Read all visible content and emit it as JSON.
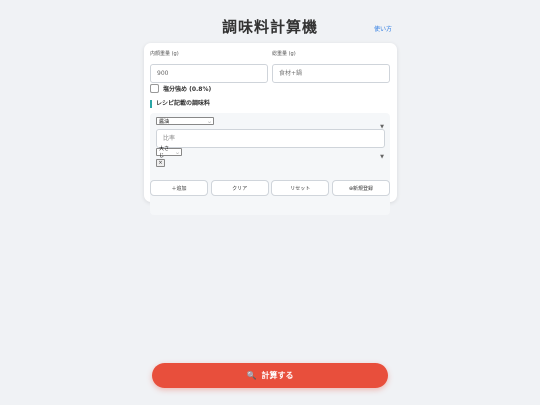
{
  "header": {
    "title": "調味料計算機",
    "help_label": "使い方"
  },
  "form": {
    "content_weight": {
      "label": "内顔重量 (g)",
      "value": "900"
    },
    "total_weight": {
      "label": "総重量 (g)",
      "placeholder": "食材+鍋"
    },
    "salt_option": {
      "label": "塩分強め (0.8%)",
      "checked": false
    }
  },
  "recipe": {
    "section_title": "レシピ記載の調味料",
    "seasoning_select": "醤油",
    "ratio_placeholder": "比率",
    "unit_select": "大さじ",
    "remove_label": "×",
    "caret_icon": "▼"
  },
  "buttons": {
    "add": "＋追加",
    "clear": "クリア",
    "reset": "リセット",
    "new_register": "⊕新規登録"
  },
  "calculate": {
    "icon": "🔍",
    "label": "計算する"
  },
  "colors": {
    "accent_red": "#e84f3c",
    "link_blue": "#2a7ae2",
    "section_teal": "#2aa6a6"
  }
}
